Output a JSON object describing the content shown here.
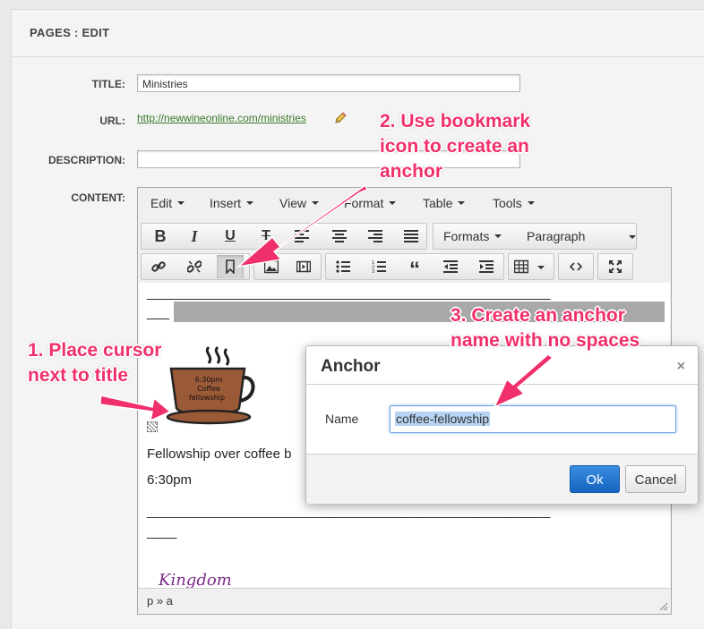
{
  "page": {
    "header_title": "PAGES : EDIT"
  },
  "form": {
    "title_label": "TITLE:",
    "title_value": "Ministries",
    "url_label": "URL:",
    "url_value": "http://newwineonline.com/ministries",
    "description_label": "DESCRIPTION:",
    "description_value": "",
    "content_label": "CONTENT:"
  },
  "editor": {
    "menus": [
      "Edit",
      "Insert",
      "View",
      "Format",
      "Table",
      "Tools"
    ],
    "formats_label": "Formats",
    "block_label": "Paragraph",
    "content": {
      "rule_line1": "______________________________________________________",
      "rule_tail1": "___",
      "cup_text_time": "6:30pm",
      "cup_text_line1": "Coffee",
      "cup_text_line2": "fellowship",
      "paragraph1": "Fellowship over coffee b",
      "paragraph2": "6:30pm",
      "rule_line2": "______________________________________________________",
      "rule_tail2": "____",
      "partial_text": "Kingdom"
    },
    "status_path": "p » a"
  },
  "dialog": {
    "title": "Anchor",
    "close_glyph": "×",
    "name_label": "Name",
    "name_value": "coffee-fellowship",
    "ok_label": "Ok",
    "cancel_label": "Cancel"
  },
  "annotations": {
    "step1_line1": "1. Place cursor",
    "step1_line2": "next to title",
    "step2_line1": "2. Use bookmark",
    "step2_line2": "icon to create an",
    "step2_line3": "anchor",
    "step3_line1": "3. Create an anchor",
    "step3_line2": "name with no spaces"
  },
  "colors": {
    "annotation": "#f0306a",
    "link": "#3a7a2b",
    "primary_button": "#1a6fcc",
    "selection": "#b7d3f3"
  },
  "icons": [
    "pencil-icon",
    "bold-icon",
    "italic-icon",
    "underline-icon",
    "strikethrough-icon",
    "align-left-icon",
    "align-center-icon",
    "align-right-icon",
    "align-justify-icon",
    "link-icon",
    "unlink-icon",
    "bookmark-icon",
    "image-icon",
    "media-icon",
    "bullet-list-icon",
    "numbered-list-icon",
    "blockquote-icon",
    "outdent-icon",
    "indent-icon",
    "table-icon",
    "code-icon",
    "fullscreen-icon",
    "close-icon",
    "resize-icon"
  ]
}
